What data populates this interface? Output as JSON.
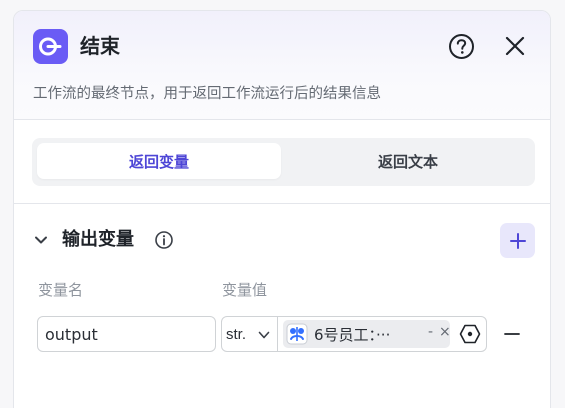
{
  "node": {
    "title": "结束",
    "description": "工作流的最终节点，用于返回工作流运行后的结果信息",
    "accent_color": "#6a5cf5",
    "icon": "end-node-icon"
  },
  "header_actions": {
    "help_icon": "question-circle-icon",
    "close_icon": "close-icon"
  },
  "mode_tabs": [
    {
      "label": "返回变量",
      "active": true
    },
    {
      "label": "返回文本",
      "active": false
    }
  ],
  "output_section": {
    "title": "输出变量",
    "info_icon": "info-icon",
    "add_icon": "plus-icon",
    "columns": {
      "name": "变量名",
      "value": "变量值"
    },
    "rows": [
      {
        "name": "output",
        "type": "str.",
        "reference": "6号员工：···",
        "reference_suffix": "-",
        "clear_glyph": "×"
      }
    ]
  }
}
